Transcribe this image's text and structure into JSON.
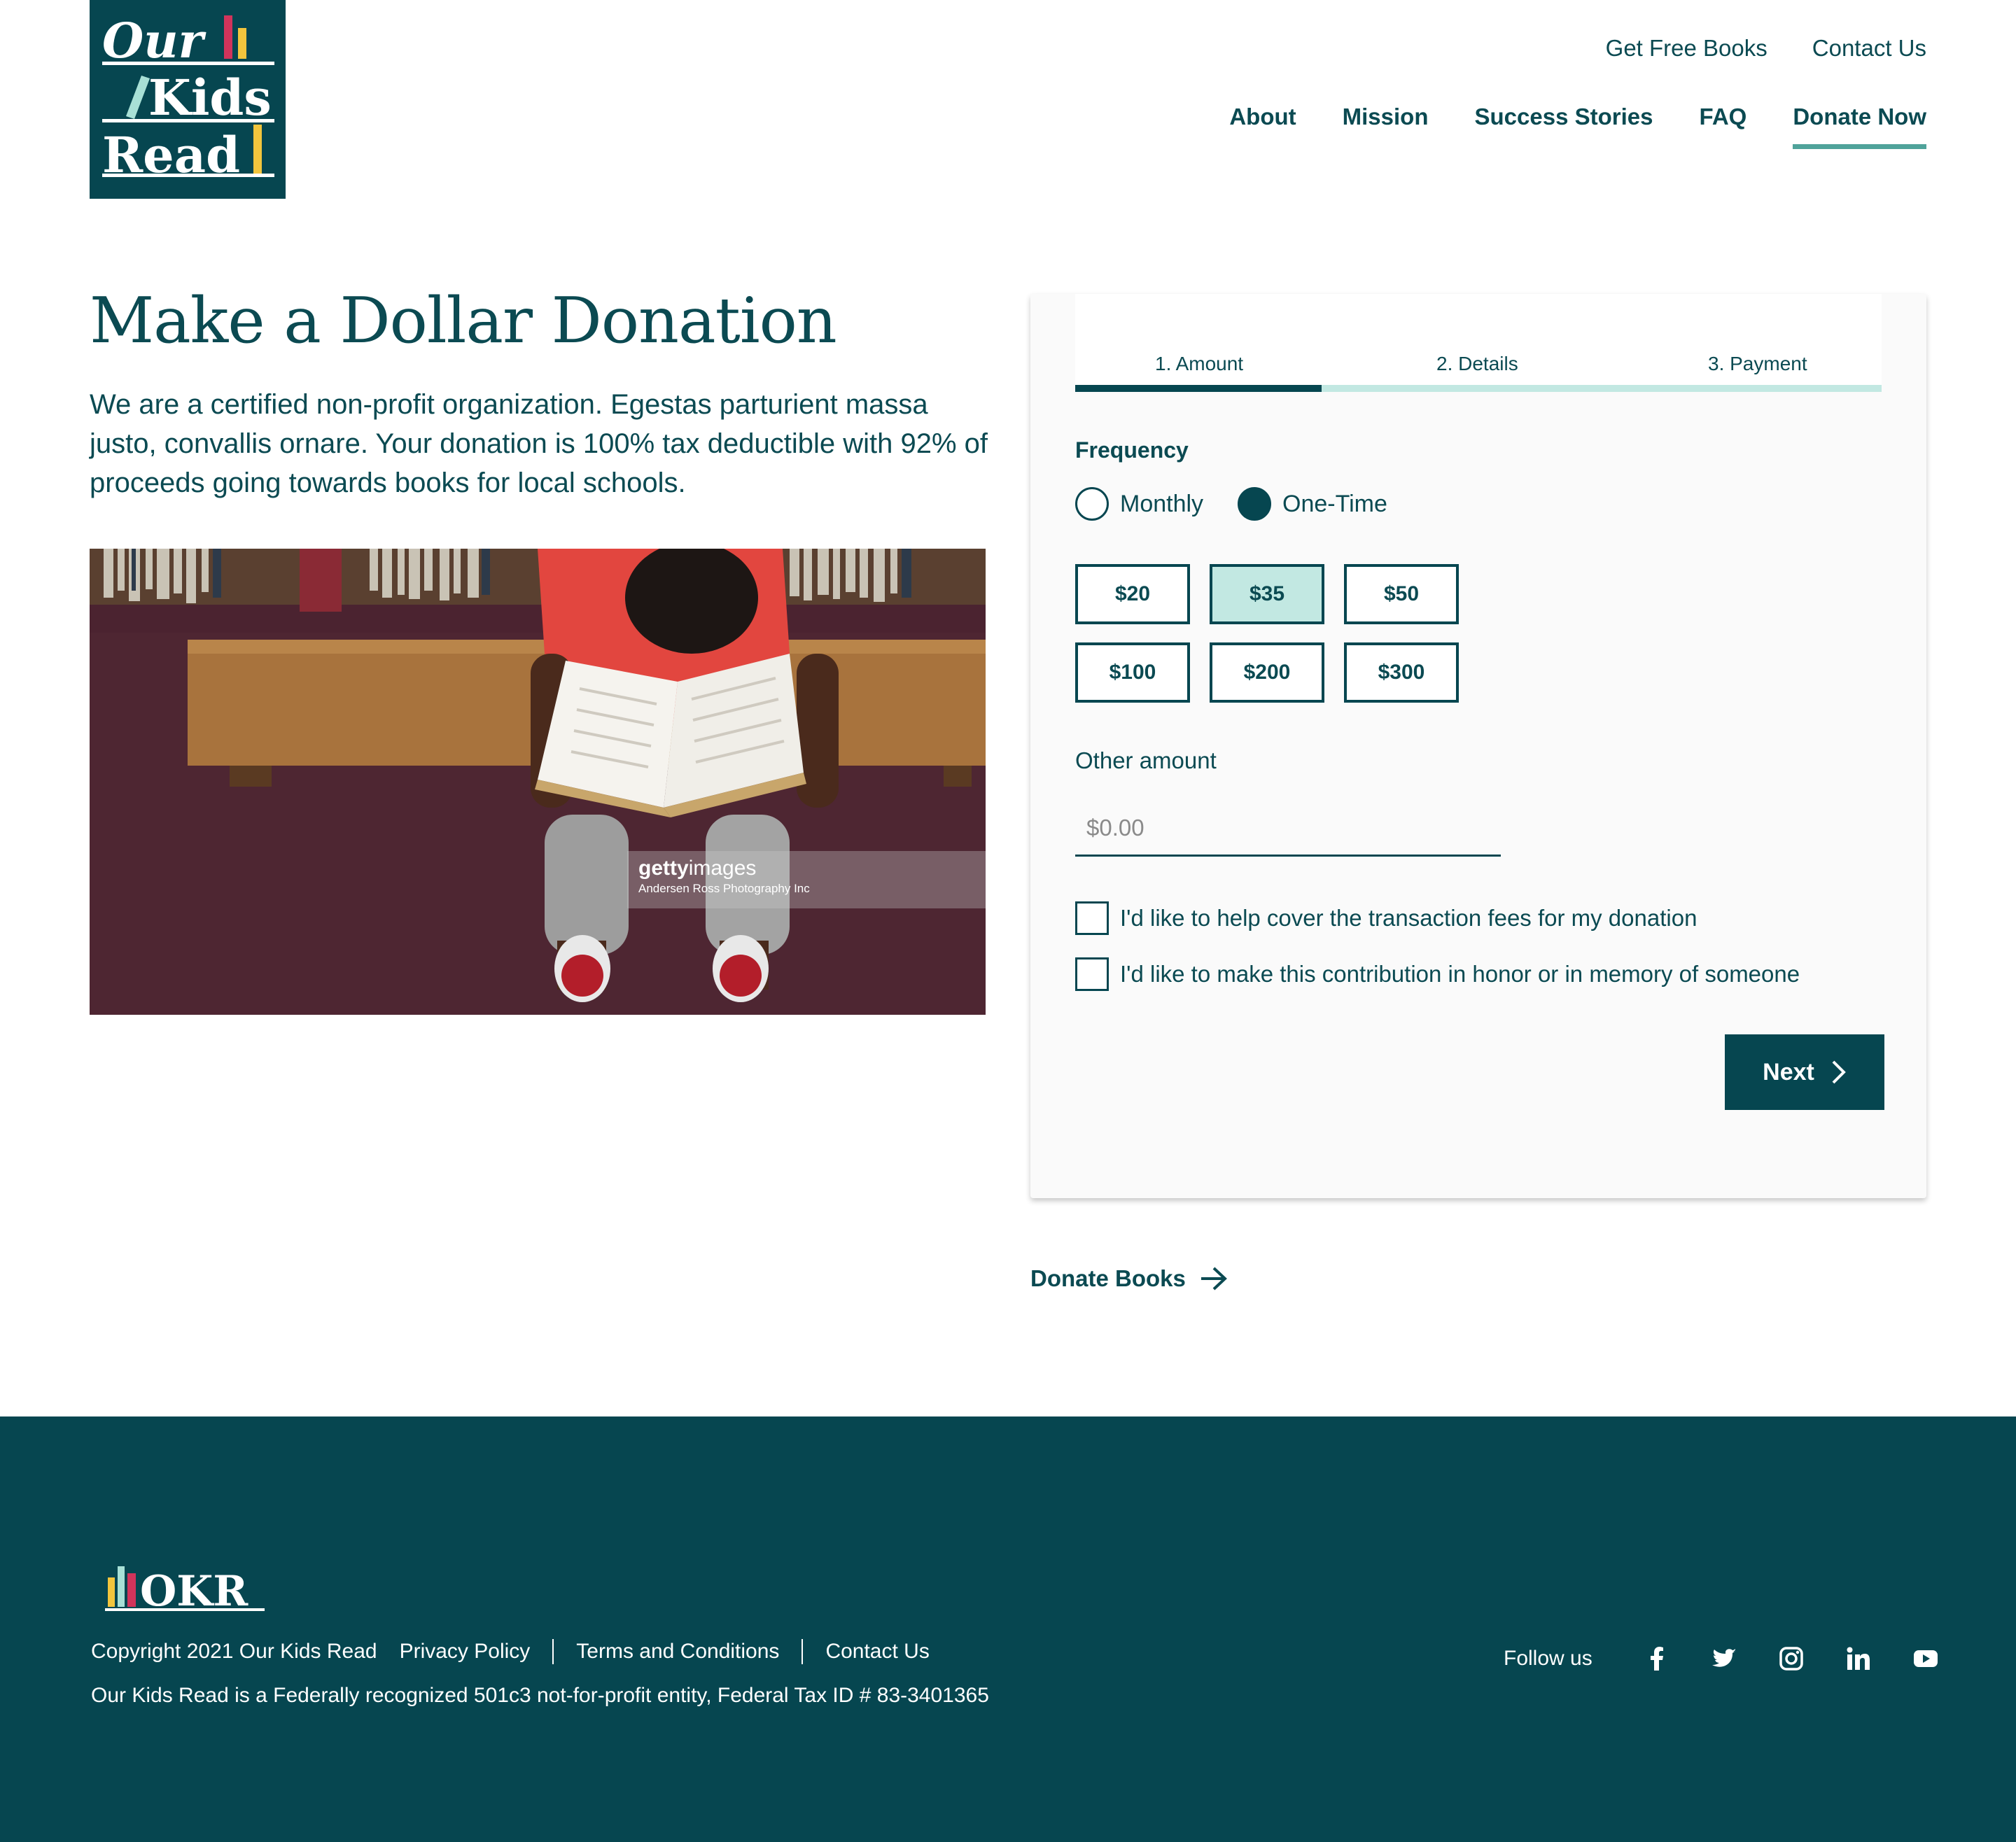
{
  "brand": {
    "logo_lines": [
      "Our",
      "Kids",
      "Read"
    ],
    "footer_logo_text": "OKR",
    "colors": {
      "teal_dark": "#064650",
      "teal_text": "#0b4a52",
      "mint": "#c2e8e2",
      "accent_green": "#4fa39a",
      "bar_pink": "#d1345b",
      "bar_yellow": "#f2c53d",
      "bar_mint": "#a8e0d6"
    }
  },
  "header": {
    "top_links": [
      "Get Free Books",
      "Contact Us"
    ],
    "nav": [
      "About",
      "Mission",
      "Success Stories",
      "FAQ",
      "Donate Now"
    ],
    "active_nav": "Donate Now"
  },
  "main": {
    "title": "Make a Dollar Donation",
    "intro": "We are a certified non-profit organization. Egestas parturient massa justo, convallis ornare. Your donation is 100% tax deductible with 92% of proceeds going towards books for local schools.",
    "photo": {
      "watermark_brand": "getty",
      "watermark_brand_suffix": "images",
      "watermark_credit": "Andersen Ross Photography Inc"
    }
  },
  "donation_form": {
    "steps": [
      "1. Amount",
      "2. Details",
      "3. Payment"
    ],
    "current_step": 1,
    "frequency_label": "Frequency",
    "frequency_options": [
      "Monthly",
      "One-Time"
    ],
    "frequency_selected": "One-Time",
    "amounts": [
      "$20",
      "$35",
      "$50",
      "$100",
      "$200",
      "$300"
    ],
    "amount_selected": "$35",
    "other_amount_label": "Other amount",
    "other_amount_placeholder": "$0.00",
    "checkboxes": [
      "I'd like to help cover the transaction fees for my donation",
      "I'd like to make this contribution in honor or in memory of someone"
    ],
    "next_label": "Next",
    "next_icon": "chevron-right-icon"
  },
  "donate_books_link": {
    "label": "Donate Books",
    "icon": "arrow-right-icon"
  },
  "footer": {
    "copyright": "Copyright 2021  Our Kids Read",
    "links": [
      "Privacy Policy",
      "Terms and Conditions",
      "Contact Us"
    ],
    "legal": "Our Kids Read is a Federally recognized 501c3 not-for-profit entity, Federal Tax ID # 83-3401365",
    "follow_label": "Follow us",
    "social_icons": [
      "facebook-icon",
      "twitter-icon",
      "instagram-icon",
      "linkedin-icon",
      "youtube-icon"
    ]
  }
}
